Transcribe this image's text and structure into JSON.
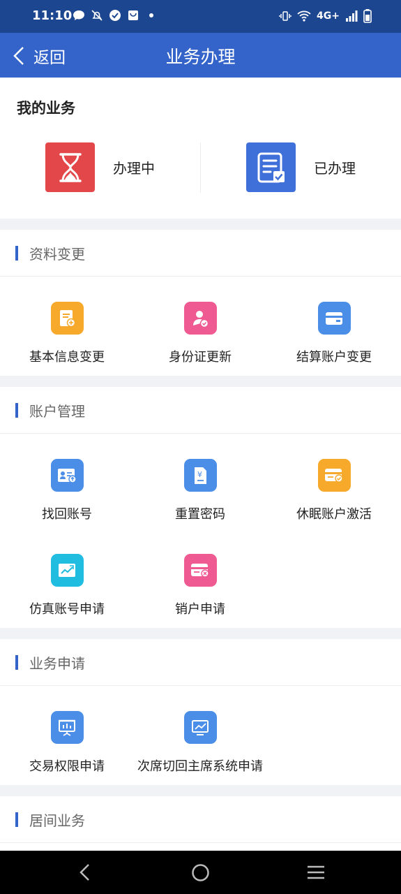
{
  "status_bar": {
    "time": "11:10",
    "network": "4G+"
  },
  "nav": {
    "back_label": "返回",
    "title": "业务办理"
  },
  "my_business": {
    "heading": "我的业务",
    "items": [
      {
        "label": "办理中",
        "icon": "hourglass-icon",
        "color": "#e4474a"
      },
      {
        "label": "已办理",
        "icon": "checklist-icon",
        "color": "#3f6fd8"
      }
    ]
  },
  "sections": [
    {
      "title": "资料变更",
      "items": [
        {
          "label": "基本信息变更",
          "icon": "document-plus-icon",
          "color": "#f6a92a"
        },
        {
          "label": "身份证更新",
          "icon": "id-person-icon",
          "color": "#ee5a91"
        },
        {
          "label": "结算账户变更",
          "icon": "card-icon",
          "color": "#4a8ee8"
        }
      ]
    },
    {
      "title": "账户管理",
      "items": [
        {
          "label": "找回账号",
          "icon": "account-card-icon",
          "color": "#4a8ee8"
        },
        {
          "label": "重置密码",
          "icon": "password-doc-icon",
          "color": "#4a8ee8"
        },
        {
          "label": "休眠账户激活",
          "icon": "card-check-icon",
          "color": "#f6a92a"
        },
        {
          "label": "仿真账号申请",
          "icon": "chart-card-icon",
          "color": "#20bde0"
        },
        {
          "label": "销户申请",
          "icon": "card-cancel-icon",
          "color": "#ee5a91"
        }
      ]
    },
    {
      "title": "业务申请",
      "items": [
        {
          "label": "交易权限申请",
          "icon": "presentation-icon",
          "color": "#4a8ee8"
        },
        {
          "label": "次席切回主席系统申请",
          "icon": "monitor-chart-icon",
          "color": "#4a8ee8"
        }
      ]
    },
    {
      "title": "居间业务",
      "items": []
    }
  ]
}
